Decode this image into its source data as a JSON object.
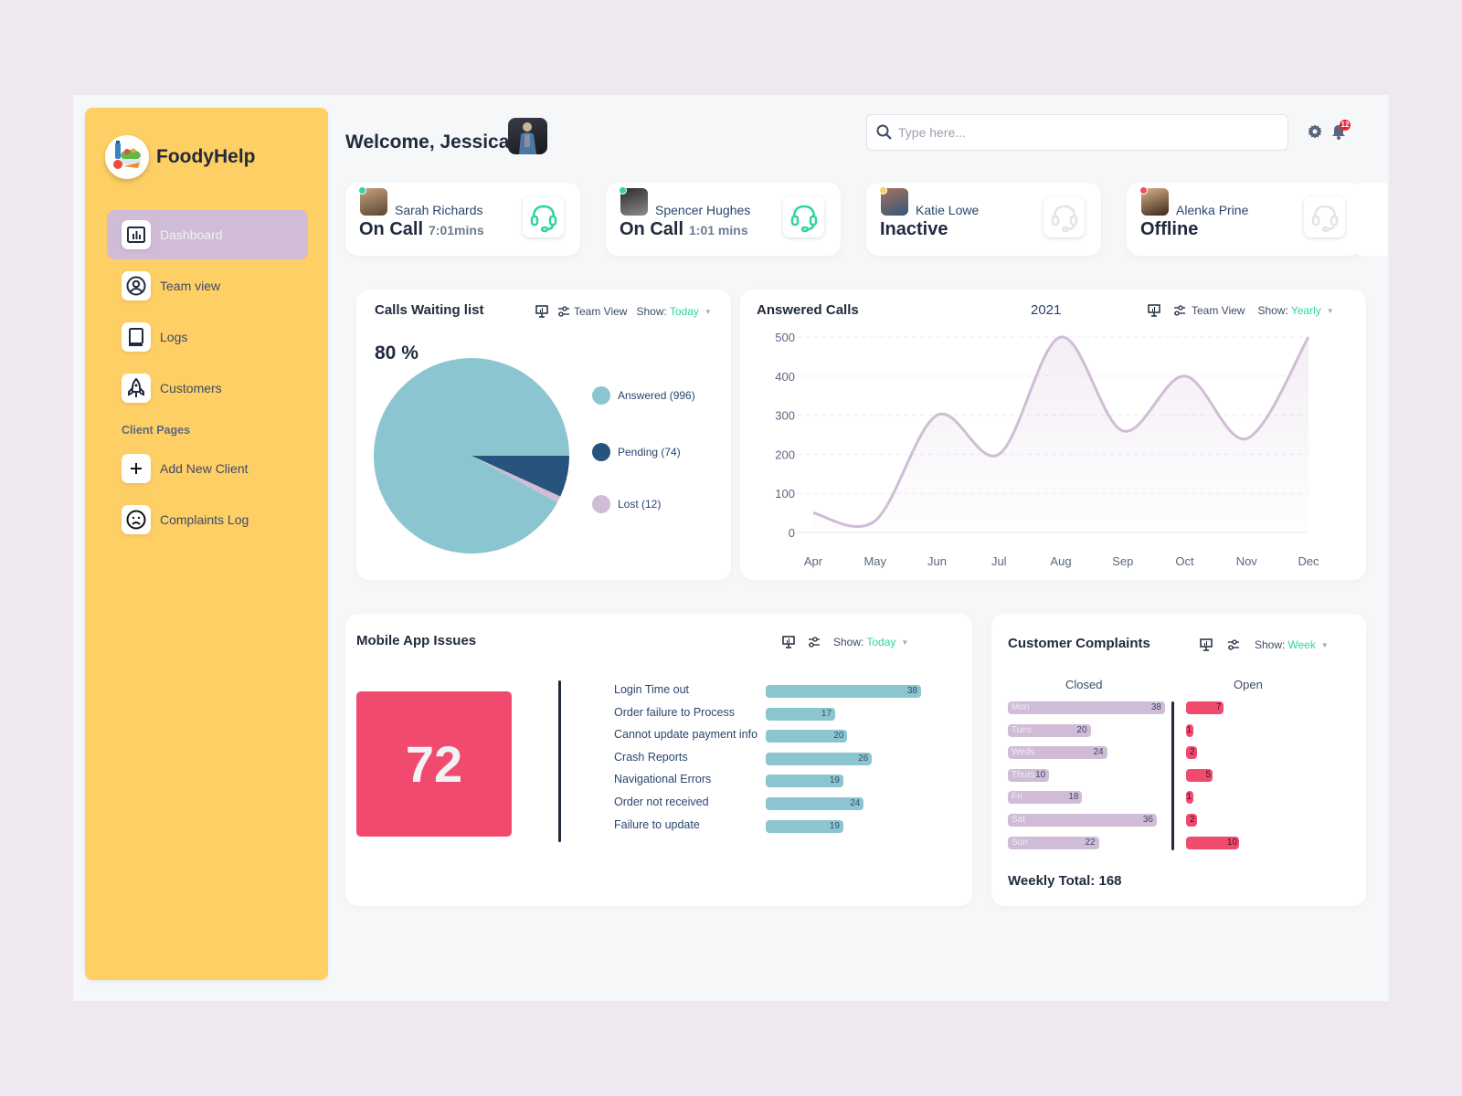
{
  "app": {
    "name": "FoodyHelp",
    "logo_icon": "food-basket-logo"
  },
  "sidebar": {
    "items": [
      {
        "label": "Dashboard",
        "icon": "bar-chart-icon",
        "active": true
      },
      {
        "label": "Team view",
        "icon": "user-circle-icon",
        "active": false
      },
      {
        "label": "Logs",
        "icon": "book-icon",
        "active": false
      },
      {
        "label": "Customers",
        "icon": "rocket-icon",
        "active": false
      }
    ],
    "section_label": "Client Pages",
    "client_items": [
      {
        "label": "Add New Client",
        "icon": "plus-icon"
      },
      {
        "label": "Complaints Log",
        "icon": "sad-face-icon"
      }
    ]
  },
  "header": {
    "welcome": "Welcome, Jessica",
    "search_placeholder": "Type here...",
    "search_value": "",
    "notification_count": "12"
  },
  "agents": [
    {
      "name": "Sarah Richards",
      "status": "On Call",
      "time": "7:01mins",
      "dot_color": "#2fd3a4",
      "active": true
    },
    {
      "name": "Spencer Hughes",
      "status": "On Call",
      "time": "1:01 mins",
      "dot_color": "#2fd3a4",
      "active": true
    },
    {
      "name": "Katie Lowe",
      "status": "Inactive",
      "time": "",
      "dot_color": "#fecf65",
      "active": false
    },
    {
      "name": "Alenka Prine",
      "status": "Offline",
      "time": "",
      "dot_color": "#f04a6f",
      "active": false
    }
  ],
  "calls_waiting": {
    "title": "Calls Waiting list",
    "team_view": "Team View",
    "show_label": "Show:",
    "show_value": "Today",
    "percent": "80 %"
  },
  "answered_calls": {
    "title": "Answered Calls",
    "year": "2021",
    "team_view": "Team View",
    "show_label": "Show:",
    "show_value": "Yearly"
  },
  "mobile_issues": {
    "title": "Mobile App Issues",
    "show_label": "Show:",
    "show_value": "Today",
    "total": "72"
  },
  "complaints": {
    "title": "Customer Complaints",
    "show_label": "Show:",
    "show_value": "Week",
    "closed_label": "Closed",
    "open_label": "Open",
    "weekly_total_label": "Weekly Total:",
    "weekly_total_value": "168"
  },
  "colors": {
    "sidebar": "#fecf65",
    "active_nav": "#d0bcd6",
    "accent_green": "#2fd3a4",
    "answered": "#8bc6d0",
    "pending": "#27547d",
    "lost": "#d0bcd6",
    "alert": "#f04a6f",
    "line": "#d0bcd6"
  },
  "chart_data": [
    {
      "type": "pie",
      "title": "Calls Waiting list",
      "labels": [
        "Answered (996)",
        "Pending (74)",
        "Lost (12)"
      ],
      "values": [
        996,
        74,
        12
      ],
      "colors": [
        "#8bc6d0",
        "#27547d",
        "#d0bcd6"
      ],
      "legend": "right"
    },
    {
      "type": "line",
      "title": "Answered Calls",
      "subtitle": "2021",
      "x": [
        "Apr",
        "May",
        "Jun",
        "Jul",
        "Aug",
        "Sep",
        "Oct",
        "Nov",
        "Dec"
      ],
      "values": [
        50,
        30,
        300,
        200,
        500,
        260,
        400,
        240,
        500
      ],
      "yticks": [
        0,
        100,
        200,
        300,
        400,
        500
      ],
      "ylim": [
        0,
        500
      ],
      "grid": true
    },
    {
      "type": "bar",
      "title": "Mobile App Issues",
      "orientation": "horizontal",
      "categories": [
        "Login Time out",
        "Order failure to Process",
        "Cannot update payment info",
        "Crash Reports",
        "Navigational Errors",
        "Order not received",
        "Failure to update"
      ],
      "values": [
        38,
        17,
        20,
        26,
        19,
        24,
        19
      ]
    },
    {
      "type": "bar",
      "title": "Customer Complaints",
      "orientation": "horizontal",
      "categories": [
        "Mon",
        "Tues",
        "Weds",
        "Thurs",
        "Fri",
        "Sat",
        "Sun"
      ],
      "series": [
        {
          "name": "Closed",
          "values": [
            38,
            20,
            24,
            10,
            18,
            36,
            22
          ]
        },
        {
          "name": "Open",
          "values": [
            7,
            1,
            2,
            5,
            1,
            2,
            10
          ]
        }
      ]
    }
  ]
}
